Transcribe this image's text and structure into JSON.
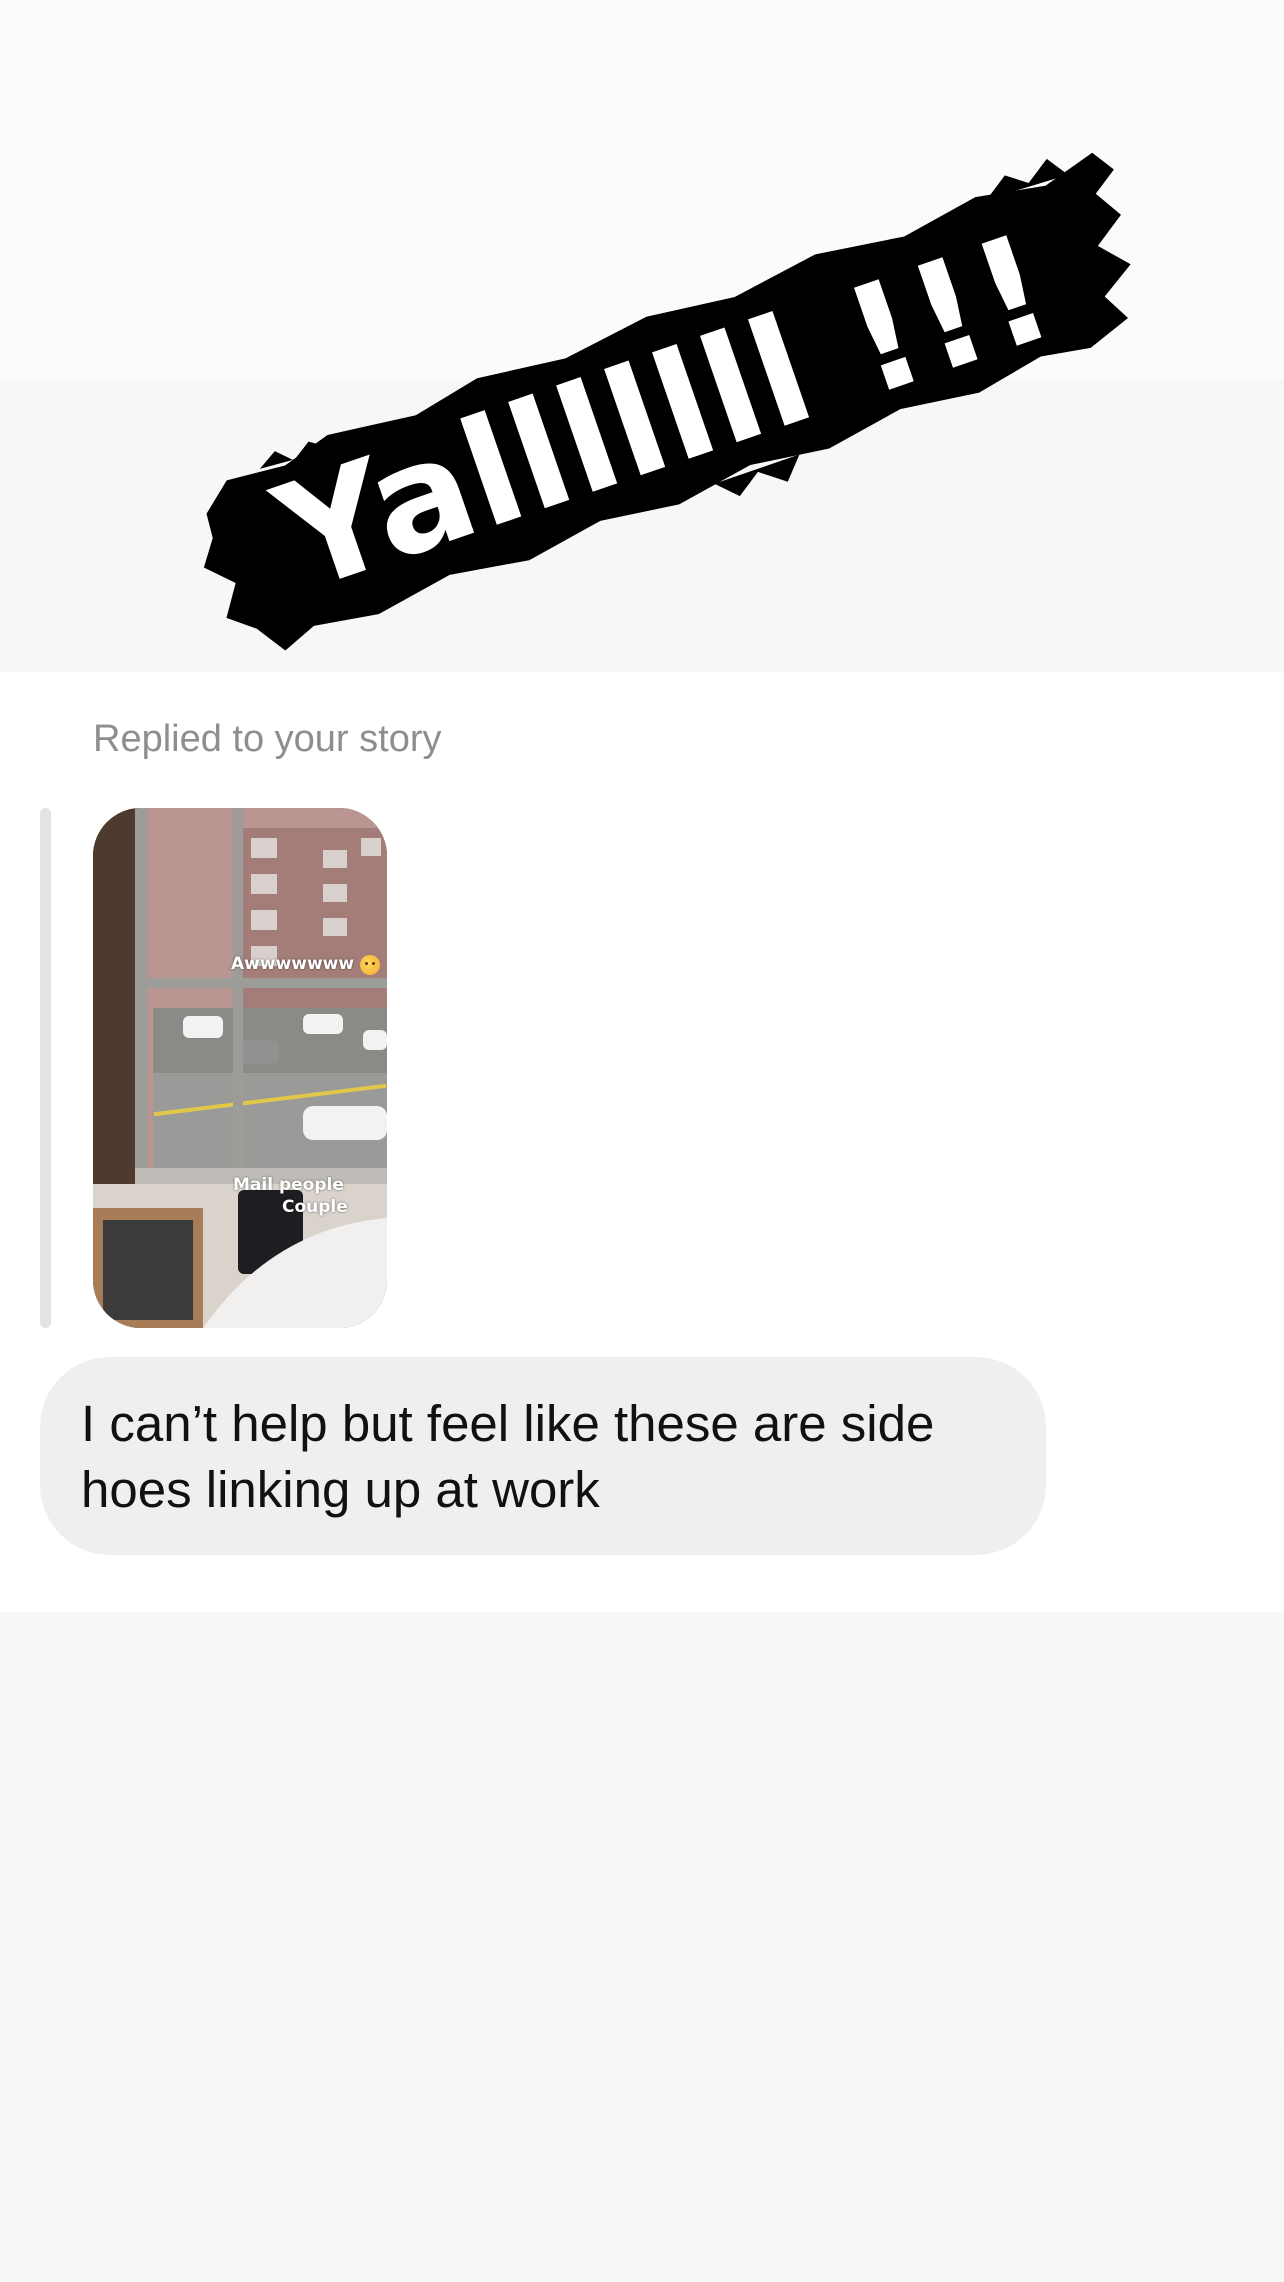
{
  "story_sticker": {
    "text": "Yalllllll !!!",
    "colors": {
      "brush": "#000000",
      "letters": "#ffffff"
    }
  },
  "reply_context": {
    "label": "Replied to your story",
    "story_preview": {
      "overlay_text_top": "Awwwwwww",
      "overlay_emoji": "smiling-face-with-hearts",
      "overlay_text_bottom_line1": "Mail people",
      "overlay_text_bottom_line2": "Couple"
    }
  },
  "message": {
    "text": "I can’t help but feel like these are side hoes linking up at work",
    "bubble_color": "#efefef"
  }
}
